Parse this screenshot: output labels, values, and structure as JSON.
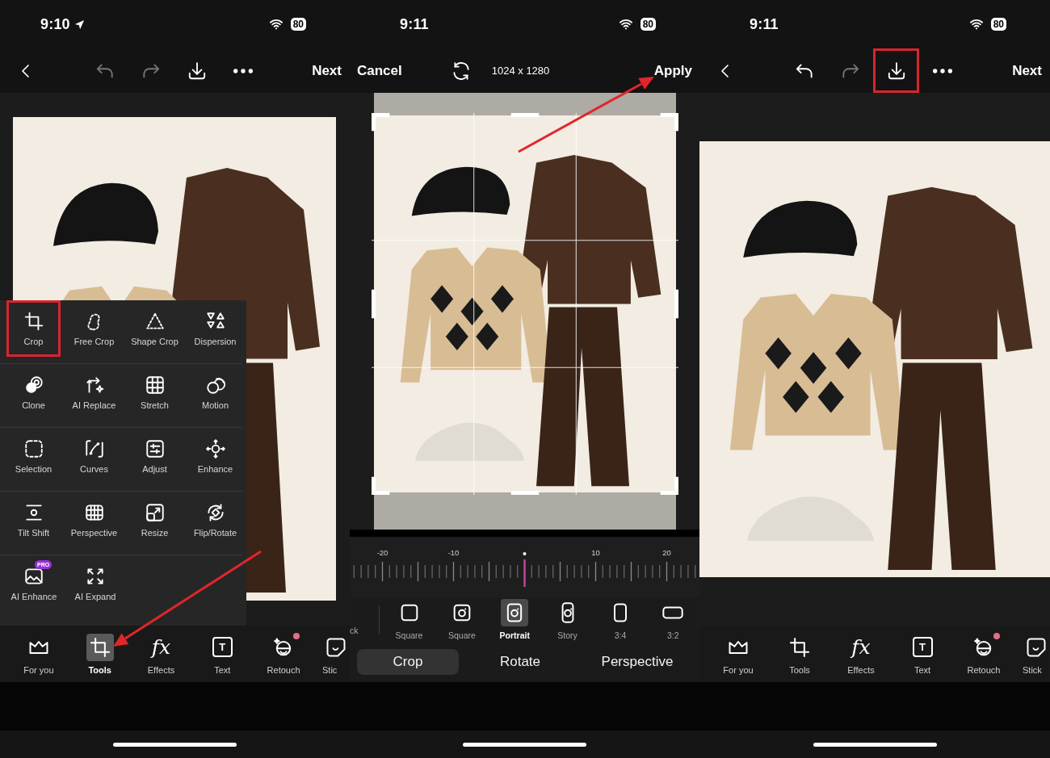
{
  "screens": [
    {
      "kind": "tools",
      "status_bar": {
        "time": "9:10",
        "location": true,
        "battery": "80"
      },
      "toolbar": {
        "buttons": [
          {
            "kind": "back",
            "disabled": false,
            "highlighted": false
          },
          {
            "kind": "undo",
            "disabled": true,
            "highlighted": false
          },
          {
            "kind": "redo",
            "disabled": true,
            "highlighted": false
          },
          {
            "kind": "download",
            "disabled": false,
            "highlighted": false
          },
          {
            "kind": "more",
            "disabled": false,
            "highlighted": false
          }
        ],
        "next": "Next"
      },
      "tools": [
        {
          "label": "Crop",
          "highlighted": true
        },
        {
          "label": "Free Crop",
          "highlighted": false
        },
        {
          "label": "Shape Crop",
          "highlighted": false
        },
        {
          "label": "Dispersion",
          "highlighted": false
        },
        {
          "label": "Clone",
          "highlighted": false
        },
        {
          "label": "AI Replace",
          "highlighted": false
        },
        {
          "label": "Stretch",
          "highlighted": false
        },
        {
          "label": "Motion",
          "highlighted": false
        },
        {
          "label": "Selection",
          "highlighted": false
        },
        {
          "label": "Curves",
          "highlighted": false
        },
        {
          "label": "Adjust",
          "highlighted": false
        },
        {
          "label": "Enhance",
          "highlighted": false
        },
        {
          "label": "Tilt Shift",
          "highlighted": false
        },
        {
          "label": "Perspective",
          "highlighted": false
        },
        {
          "label": "Resize",
          "highlighted": false
        },
        {
          "label": "Flip/Rotate",
          "highlighted": false
        },
        {
          "label": "AI Enhance",
          "highlighted": false,
          "badge": "PRO"
        },
        {
          "label": "AI Expand",
          "highlighted": false
        }
      ],
      "tabs": [
        {
          "label": "For you",
          "kind": "icon",
          "selected": false,
          "dot": false
        },
        {
          "label": "Tools",
          "kind": "icon",
          "selected": true,
          "dot": false
        },
        {
          "label": "Effects",
          "kind": "script",
          "glyph": "fx",
          "selected": false,
          "dot": false
        },
        {
          "label": "Text",
          "kind": "boxed",
          "glyph": "T",
          "selected": false,
          "dot": false
        },
        {
          "label": "Retouch",
          "kind": "icon",
          "selected": false,
          "dot": true
        },
        {
          "label": "Stic",
          "kind": "icon",
          "selected": false,
          "dot": false
        }
      ]
    },
    {
      "kind": "crop",
      "status_bar": {
        "time": "9:11",
        "location": false,
        "battery": "80"
      },
      "cancel": "Cancel",
      "size": "1024 x 1280",
      "apply": "Apply",
      "ruler": {
        "labels": [
          "-20",
          "-10",
          "10",
          "20"
        ],
        "level": 0.5
      },
      "presets": [
        {
          "label": "ck",
          "selected": false
        },
        {
          "label": "Square",
          "selected": false
        },
        {
          "label": "Square",
          "selected": false
        },
        {
          "label": "Portrait",
          "selected": true
        },
        {
          "label": "Story",
          "selected": false
        },
        {
          "label": "3:4",
          "selected": false
        },
        {
          "label": "3:2",
          "selected": false
        }
      ],
      "modes": [
        {
          "label": "Crop",
          "selected": true
        },
        {
          "label": "Rotate",
          "selected": false
        },
        {
          "label": "Perspective",
          "selected": false
        }
      ]
    },
    {
      "kind": "editor",
      "status_bar": {
        "time": "9:11",
        "location": false,
        "battery": "80"
      },
      "toolbar": {
        "buttons": [
          {
            "kind": "back",
            "disabled": false,
            "highlighted": false
          },
          {
            "kind": "undo",
            "disabled": false,
            "highlighted": false
          },
          {
            "kind": "redo",
            "disabled": true,
            "highlighted": false
          },
          {
            "kind": "download",
            "disabled": false,
            "highlighted": true
          },
          {
            "kind": "more",
            "disabled": false,
            "highlighted": false
          }
        ],
        "next": "Next"
      },
      "tabs": [
        {
          "label": "For you",
          "kind": "icon",
          "selected": false,
          "dot": false
        },
        {
          "label": "Tools",
          "kind": "icon",
          "selected": false,
          "dot": false
        },
        {
          "label": "Effects",
          "kind": "script",
          "glyph": "fx",
          "selected": false,
          "dot": false
        },
        {
          "label": "Text",
          "kind": "boxed",
          "glyph": "T",
          "selected": false,
          "dot": false
        },
        {
          "label": "Retouch",
          "kind": "icon",
          "selected": false,
          "dot": true
        },
        {
          "label": "Stick",
          "kind": "icon",
          "selected": false,
          "dot": false
        }
      ]
    }
  ]
}
